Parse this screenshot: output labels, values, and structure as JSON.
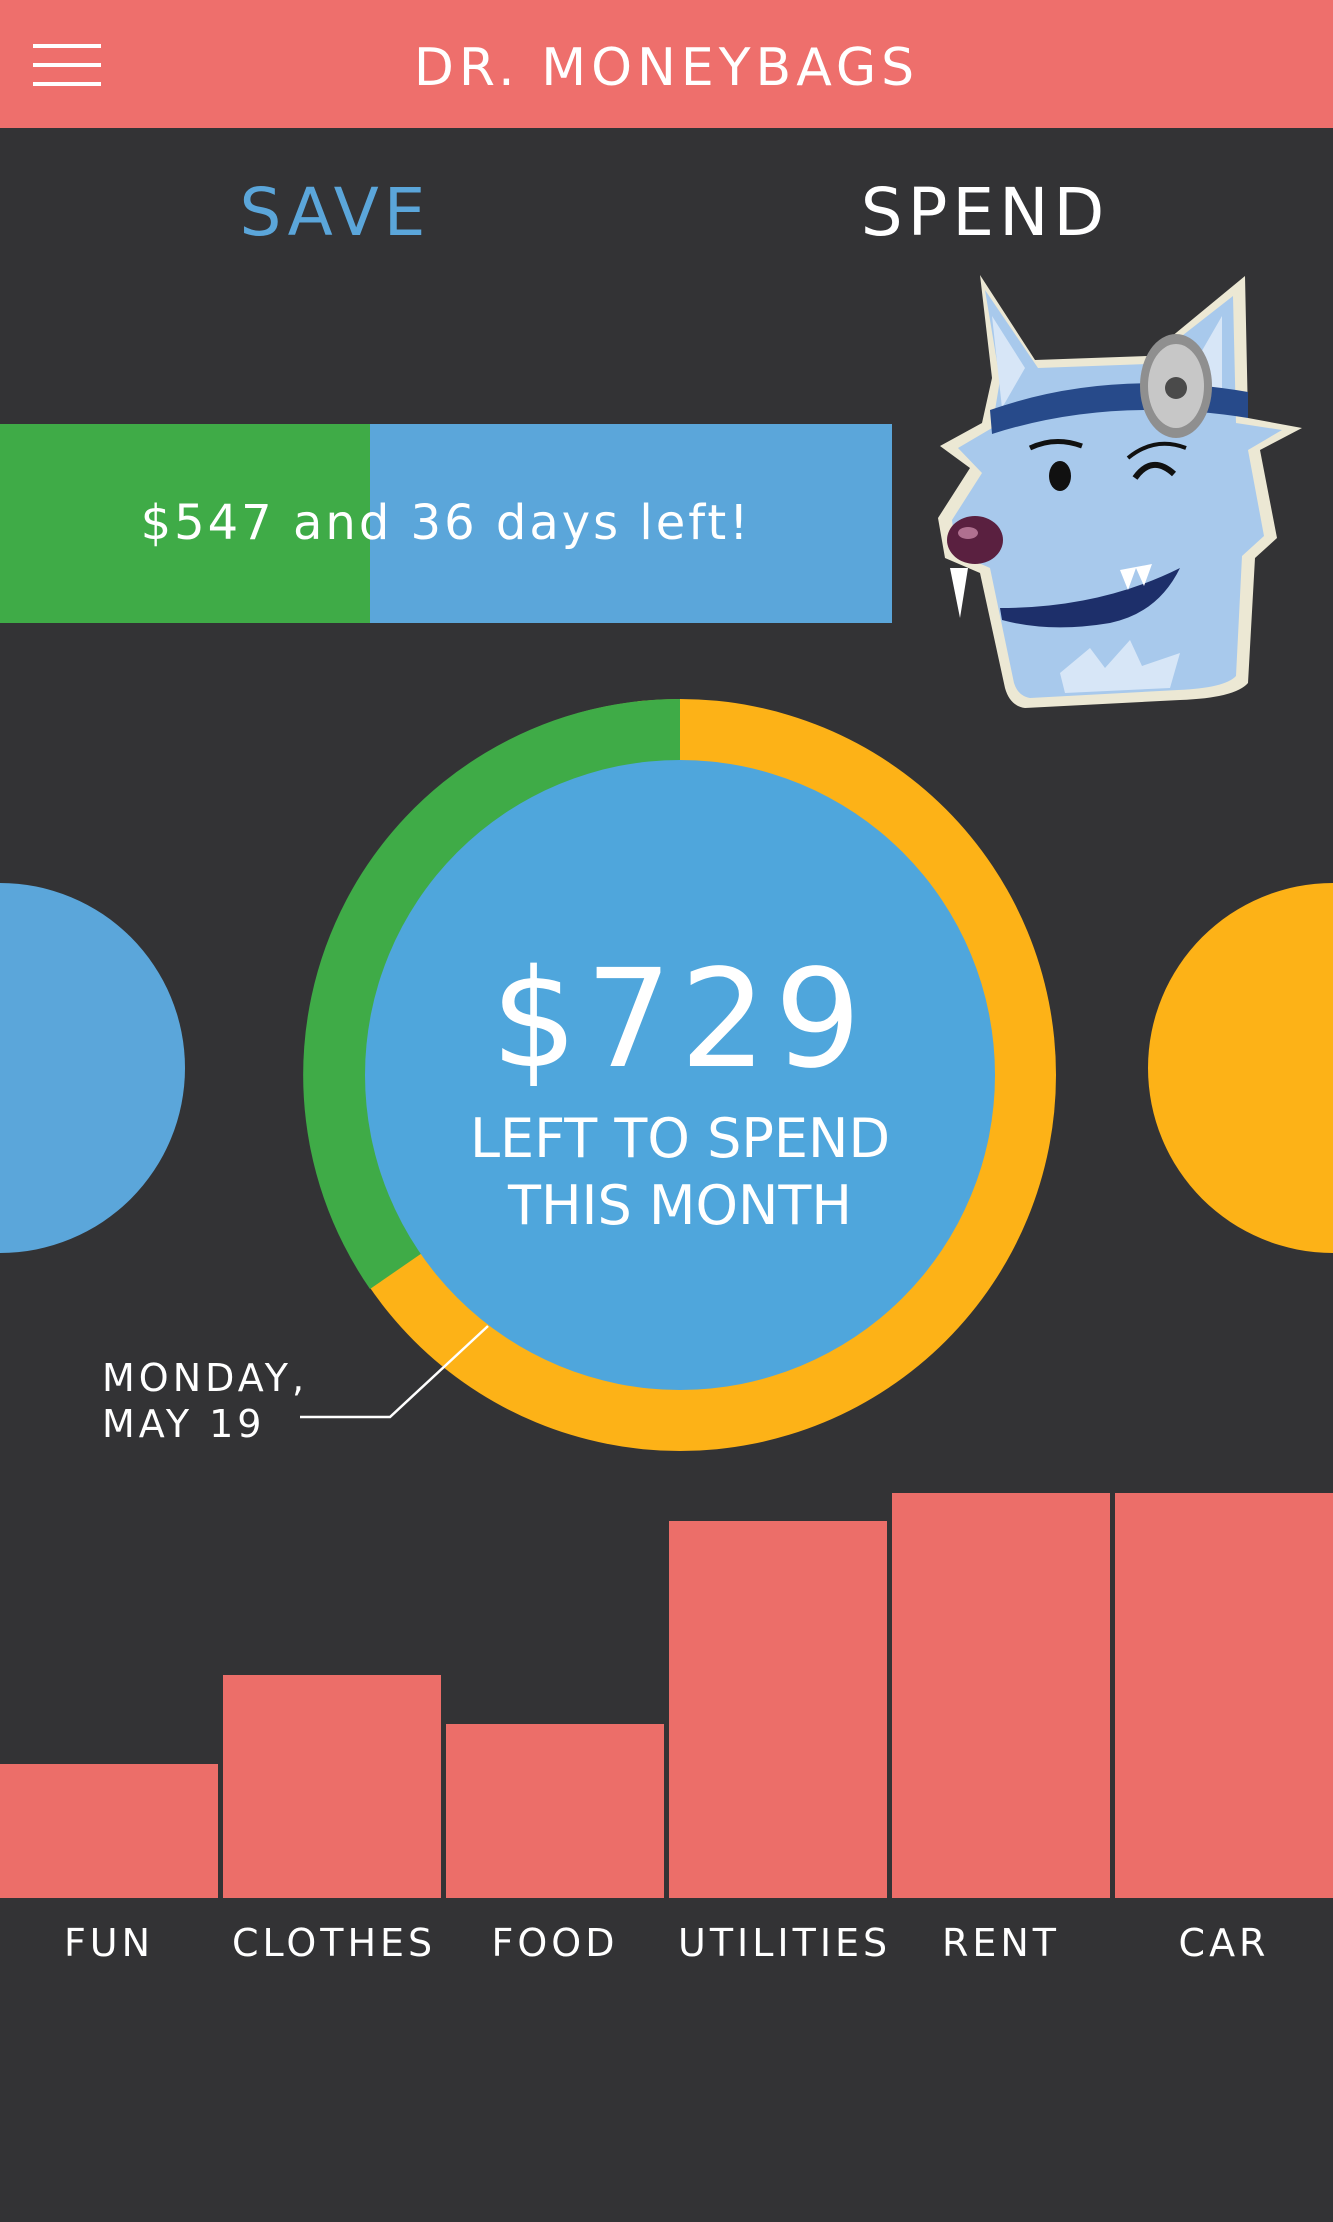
{
  "header": {
    "title": "DR. MONEYBAGS",
    "menu_icon": "hamburger-menu-icon"
  },
  "tabs": [
    {
      "label": "SAVE",
      "active": false
    },
    {
      "label": "SPEND",
      "active": true
    }
  ],
  "savings_progress": {
    "text": "$547 and 36 days left!",
    "fraction": 0.415
  },
  "spending": {
    "amount": "$729",
    "caption_line1": "LEFT TO SPEND",
    "caption_line2": "THIS MONTH",
    "date_line1": "MONDAY,",
    "date_line2": "MAY 19"
  },
  "categories": [
    {
      "label": "FUN",
      "level": 0.33
    },
    {
      "label": "CLOTHES",
      "level": 0.55
    },
    {
      "label": "FOOD",
      "level": 0.43
    },
    {
      "label": "UTILITIES",
      "level": 0.93
    },
    {
      "label": "RENT",
      "level": 1.0
    },
    {
      "label": "CAR",
      "level": 1.0
    }
  ],
  "colors": {
    "header": "#ee6f6c",
    "background": "#333335",
    "save_blue": "#5ba6da",
    "circle_blue": "#4fa6dc",
    "green": "#3fab47",
    "amber": "#fdb217",
    "bar": "#ec6e69"
  }
}
